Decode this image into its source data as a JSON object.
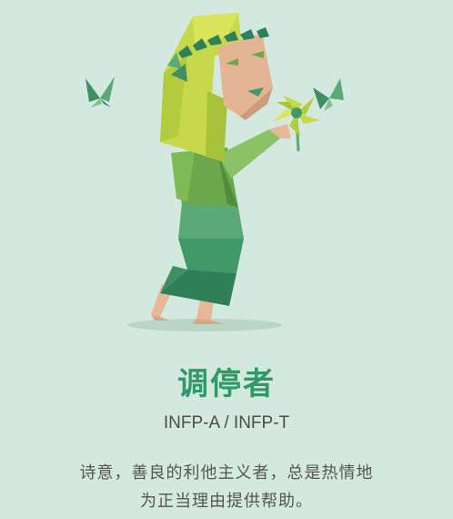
{
  "title": "调停者",
  "subtitle": "INFP-A / INFP-T",
  "description": {
    "line1": "诗意，善良的利他主义者，总是热情地",
    "line2": "为正当理由提供帮助。"
  },
  "colors": {
    "background": "#d3e9df",
    "title": "#2f9a68",
    "text": "#555555"
  },
  "illustration": {
    "subject": "low-poly-woman-holding-flower",
    "icons": [
      "butterfly-icon",
      "butterfly-icon",
      "flower-icon"
    ]
  }
}
